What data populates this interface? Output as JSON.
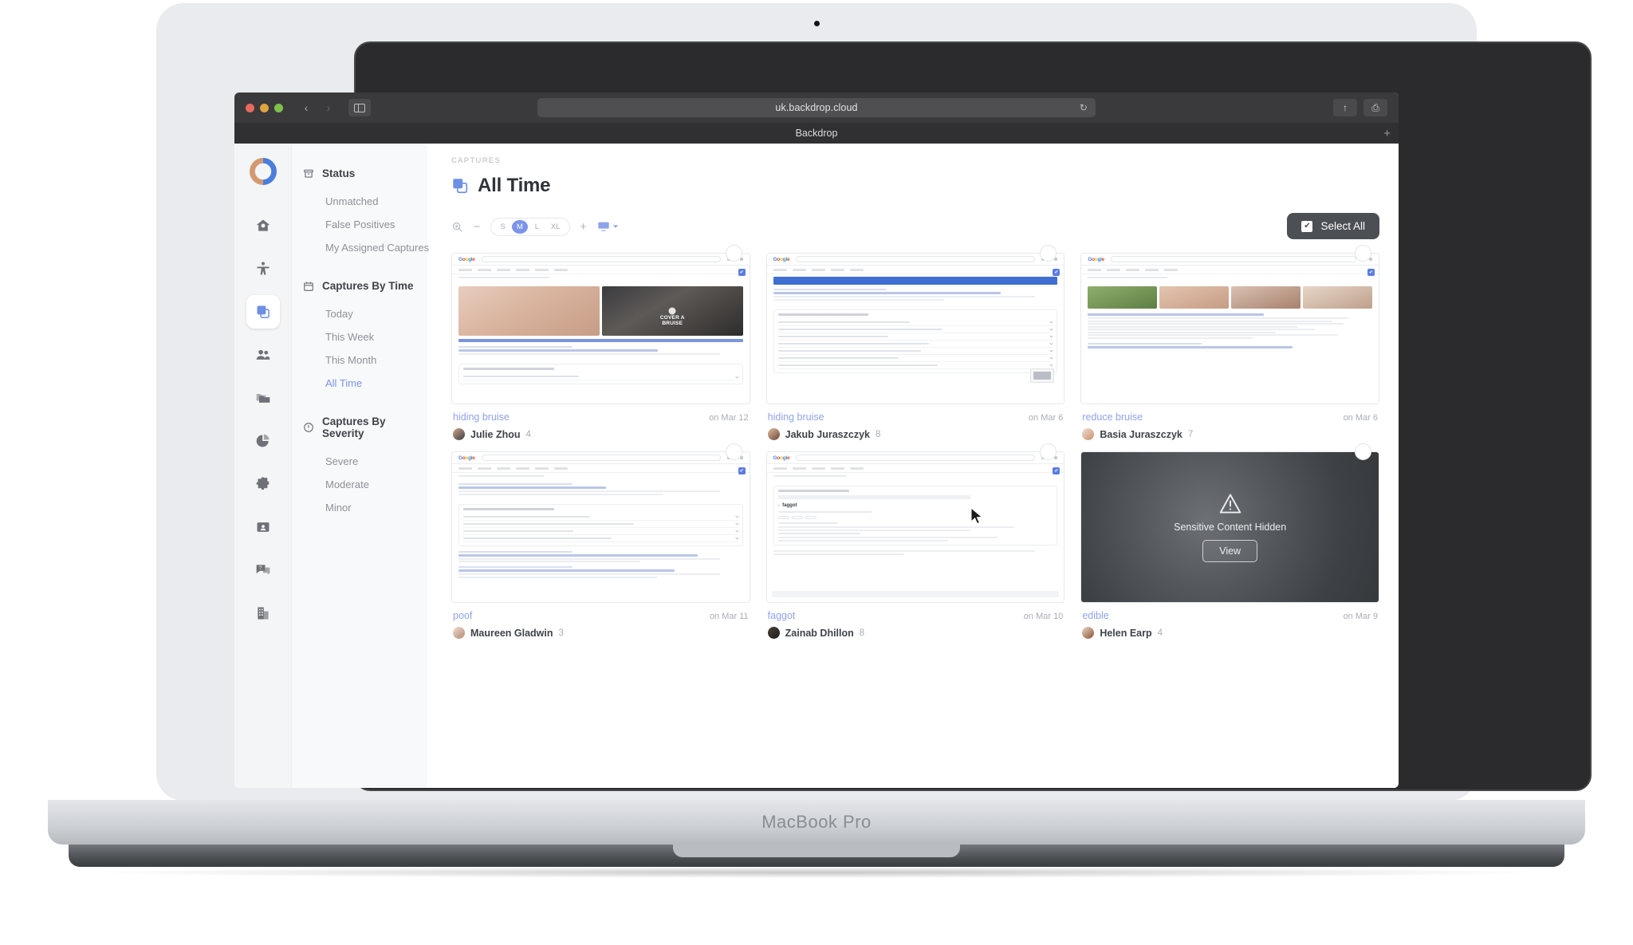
{
  "browser": {
    "url": "uk.backdrop.cloud",
    "tab_title": "Backdrop",
    "back_icon": "chevron-left-icon",
    "forward_icon": "chevron-right-icon",
    "sidebar_icon": "sidebar-toggle-icon",
    "reload_icon": "reload-icon",
    "share_icon": "share-icon",
    "tabs_icon": "new-tab-icon",
    "plus_icon": "plus-icon"
  },
  "device": {
    "model": "MacBook Pro"
  },
  "rail": {
    "logo": "backdrop-logo",
    "items": [
      {
        "name": "home",
        "icon": "home-icon"
      },
      {
        "name": "child-safety",
        "icon": "child-icon"
      },
      {
        "name": "captures",
        "icon": "captures-icon",
        "active": true
      },
      {
        "name": "users",
        "icon": "users-icon"
      },
      {
        "name": "folders",
        "icon": "folders-icon"
      },
      {
        "name": "reports",
        "icon": "pie-chart-icon"
      },
      {
        "name": "settings",
        "icon": "gear-icon"
      },
      {
        "name": "contacts",
        "icon": "id-card-icon"
      },
      {
        "name": "support",
        "icon": "chat-help-icon"
      },
      {
        "name": "organisation",
        "icon": "building-icon"
      }
    ]
  },
  "filters": {
    "groups": [
      {
        "title": "Status",
        "icon": "archive-icon",
        "items": [
          {
            "label": "Unmatched",
            "active": false
          },
          {
            "label": "False Positives",
            "active": false
          },
          {
            "label": "My Assigned Captures",
            "active": false
          }
        ]
      },
      {
        "title": "Captures By Time",
        "icon": "calendar-icon",
        "items": [
          {
            "label": "Today",
            "active": false
          },
          {
            "label": "This Week",
            "active": false
          },
          {
            "label": "This Month",
            "active": false
          },
          {
            "label": "All Time",
            "active": true
          }
        ]
      },
      {
        "title": "Captures By Severity",
        "icon": "alert-circle-icon",
        "items": [
          {
            "label": "Severe",
            "active": false
          },
          {
            "label": "Moderate",
            "active": false
          },
          {
            "label": "Minor",
            "active": false
          }
        ]
      }
    ]
  },
  "main": {
    "breadcrumb": "CAPTURES",
    "title": "All Time",
    "title_icon": "captures-icon",
    "toolbar": {
      "zoom_icon": "magnifier-icon",
      "minus": "−",
      "plus": "+",
      "sizes": [
        "S",
        "M",
        "L",
        "XL"
      ],
      "selected_size": "M",
      "view_icon": "monitor-icon",
      "view_chevron": "chevron-down-icon",
      "select_all_label": "Select All",
      "select_all_checked": true
    },
    "accent_color": "#7b93e8",
    "select_all_bg": "#4c4f54",
    "captures": [
      {
        "term": "hiding bruise",
        "date": "on Mar 12",
        "user": "Julie Zhou",
        "count": "4",
        "thumb": "serp-images",
        "sensitive": false
      },
      {
        "term": "hiding bruise",
        "date": "on Mar 6",
        "user": "Jakub Juraszczyk",
        "count": "8",
        "thumb": "serp-video",
        "sensitive": false
      },
      {
        "term": "reduce bruise",
        "date": "on Mar 6",
        "user": "Basia Juraszczyk",
        "count": "7",
        "thumb": "serp-thumbrow",
        "sensitive": false
      },
      {
        "term": "poof",
        "date": "on Mar 11",
        "user": "Maureen Gladwin",
        "count": "3",
        "thumb": "serp-text",
        "sensitive": false
      },
      {
        "term": "faggot",
        "date": "on Mar 10",
        "user": "Zainab Dhillon",
        "count": "8",
        "thumb": "serp-dictionary",
        "sensitive": false
      },
      {
        "term": "edible",
        "date": "on Mar 9",
        "user": "Helen Earp",
        "count": "4",
        "thumb": "hidden",
        "sensitive": true,
        "sensitive_text": "Sensitive Content Hidden",
        "sensitive_button": "View",
        "warning_icon": "warning-triangle-icon"
      }
    ]
  }
}
